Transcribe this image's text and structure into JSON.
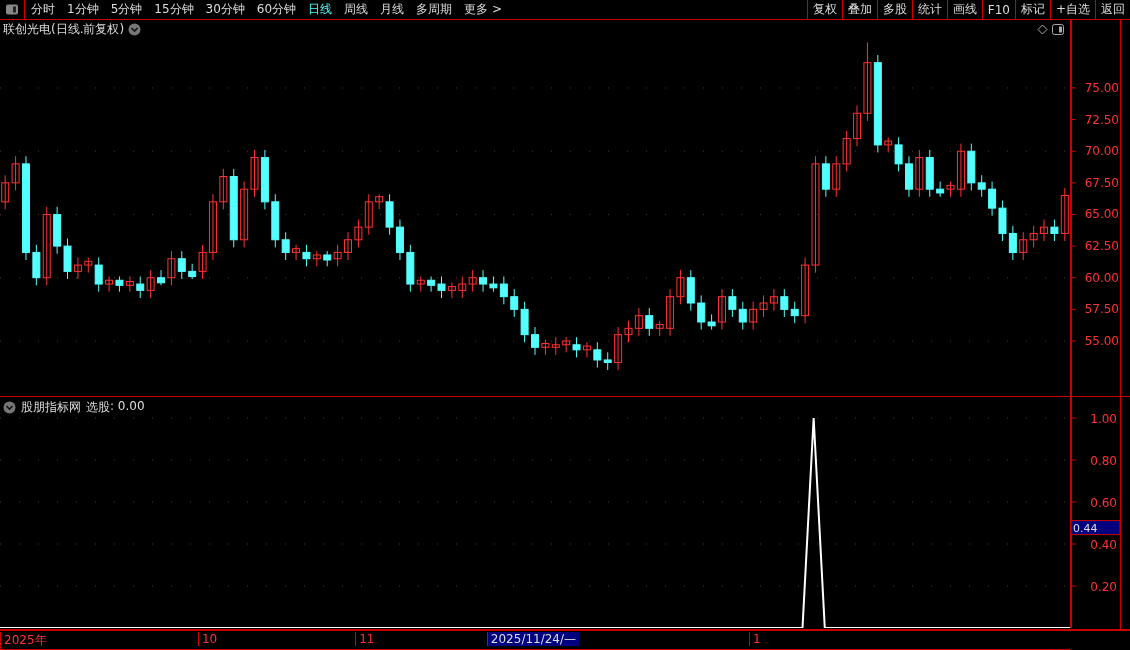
{
  "toolbar": {
    "periods": [
      {
        "label": "分时",
        "selected": false
      },
      {
        "label": "1分钟",
        "selected": false
      },
      {
        "label": "5分钟",
        "selected": false
      },
      {
        "label": "15分钟",
        "selected": false
      },
      {
        "label": "30分钟",
        "selected": false
      },
      {
        "label": "60分钟",
        "selected": false
      },
      {
        "label": "日线",
        "selected": true
      },
      {
        "label": "周线",
        "selected": false
      },
      {
        "label": "月线",
        "selected": false
      },
      {
        "label": "多周期",
        "selected": false
      },
      {
        "label": "更多 >",
        "selected": false
      }
    ],
    "actions": [
      "复权",
      "叠加",
      "多股",
      "统计",
      "画线",
      "F10",
      "标记",
      "+自选",
      "返回"
    ]
  },
  "main_chart": {
    "title": "联创光电(日线.前复权)",
    "chart_data": {
      "type": "candlestick",
      "ylim": [
        50.65,
        78.95
      ],
      "grid": true,
      "yticks": [
        {
          "value": 75,
          "label": "75.00"
        },
        {
          "value": 72.5,
          "label": "72.50"
        },
        {
          "value": 70,
          "label": "70.00"
        },
        {
          "value": 67.5,
          "label": "67.50"
        },
        {
          "value": 65,
          "label": "65.00"
        },
        {
          "value": 62.5,
          "label": "62.50"
        },
        {
          "value": 60,
          "label": "60.00"
        },
        {
          "value": 57.5,
          "label": "57.50"
        },
        {
          "value": 55,
          "label": "55.00"
        }
      ],
      "ohlc": [
        [
          66,
          68.1,
          65.4,
          67.5
        ],
        [
          67.5,
          69.6,
          66.9,
          69
        ],
        [
          69,
          69.6,
          61.4,
          62
        ],
        [
          62,
          62.6,
          59.4,
          60
        ],
        [
          60,
          65.6,
          59.4,
          65
        ],
        [
          65,
          65.6,
          61.9,
          62.5
        ],
        [
          62.5,
          63.1,
          59.9,
          60.5
        ],
        [
          60.5,
          61.6,
          59.9,
          61
        ],
        [
          61,
          61.6,
          60.4,
          61.3
        ],
        [
          61,
          61.6,
          58.9,
          59.5
        ],
        [
          59.5,
          60.1,
          58.9,
          59.8
        ],
        [
          59.8,
          60.1,
          58.9,
          59.4
        ],
        [
          59.4,
          60.1,
          58.9,
          59.7
        ],
        [
          59.5,
          60.1,
          58.4,
          59
        ],
        [
          59,
          60.6,
          58.4,
          60
        ],
        [
          60,
          60.6,
          59.4,
          59.6
        ],
        [
          60,
          62.1,
          59.4,
          61.5
        ],
        [
          61.5,
          62.1,
          59.9,
          60.5
        ],
        [
          60.5,
          61.1,
          59.9,
          60.1
        ],
        [
          60.5,
          62.6,
          59.9,
          62
        ],
        [
          62,
          66.6,
          61.4,
          66
        ],
        [
          66,
          68.6,
          65.4,
          68
        ],
        [
          68,
          68.6,
          62.4,
          63
        ],
        [
          63,
          67.6,
          62.4,
          67
        ],
        [
          67,
          70.1,
          66.4,
          69.5
        ],
        [
          69.5,
          70.1,
          65.4,
          66
        ],
        [
          66,
          66.6,
          62.4,
          63
        ],
        [
          63,
          63.6,
          61.4,
          62
        ],
        [
          62,
          62.6,
          61.4,
          62.3
        ],
        [
          62,
          62.6,
          60.9,
          61.5
        ],
        [
          61.5,
          62.1,
          60.9,
          61.8
        ],
        [
          61.8,
          62.1,
          60.9,
          61.4
        ],
        [
          61.5,
          62.6,
          60.9,
          62
        ],
        [
          62,
          63.6,
          61.4,
          63
        ],
        [
          63,
          64.6,
          62.4,
          64
        ],
        [
          64,
          66.6,
          63.4,
          66
        ],
        [
          66,
          66.6,
          65.4,
          66.4
        ],
        [
          66,
          66.6,
          63.4,
          64
        ],
        [
          64,
          64.6,
          61.4,
          62
        ],
        [
          62,
          62.6,
          58.9,
          59.5
        ],
        [
          59.5,
          60.1,
          58.9,
          59.8
        ],
        [
          59.8,
          60.1,
          58.9,
          59.4
        ],
        [
          59.5,
          60.1,
          58.4,
          59
        ],
        [
          59,
          59.6,
          58.4,
          59.3
        ],
        [
          59,
          60.1,
          58.4,
          59.5
        ],
        [
          59.5,
          60.6,
          58.9,
          60
        ],
        [
          60,
          60.6,
          58.9,
          59.5
        ],
        [
          59.5,
          60.1,
          58.9,
          59.2
        ],
        [
          59.5,
          60.1,
          57.9,
          58.5
        ],
        [
          58.5,
          59.1,
          56.9,
          57.5
        ],
        [
          57.5,
          58.1,
          54.9,
          55.5
        ],
        [
          55.5,
          56.1,
          53.9,
          54.5
        ],
        [
          54.5,
          55.1,
          53.9,
          54.8
        ],
        [
          54.5,
          55.3,
          53.9,
          54.7
        ],
        [
          54.7,
          55.3,
          54.1,
          55
        ],
        [
          54.7,
          55.3,
          53.7,
          54.3
        ],
        [
          54.3,
          54.9,
          53.7,
          54.6
        ],
        [
          54.3,
          54.9,
          52.9,
          53.5
        ],
        [
          53.5,
          54.1,
          52.7,
          53.3
        ],
        [
          53.3,
          56.1,
          52.7,
          55.5
        ],
        [
          55.5,
          56.6,
          54.9,
          56
        ],
        [
          56,
          57.6,
          55.4,
          57
        ],
        [
          57,
          57.6,
          55.4,
          56
        ],
        [
          56,
          56.6,
          55.4,
          56.3
        ],
        [
          56,
          59.1,
          55.4,
          58.5
        ],
        [
          58.5,
          60.6,
          57.9,
          60
        ],
        [
          60,
          60.6,
          57.4,
          58
        ],
        [
          58,
          58.6,
          55.9,
          56.5
        ],
        [
          56.5,
          57.1,
          55.9,
          56.2
        ],
        [
          56.5,
          59.1,
          55.9,
          58.5
        ],
        [
          58.5,
          59.1,
          56.9,
          57.5
        ],
        [
          57.5,
          58.1,
          55.9,
          56.5
        ],
        [
          56.5,
          58.1,
          55.9,
          57.5
        ],
        [
          57.5,
          58.6,
          56.9,
          58
        ],
        [
          58,
          59.1,
          57.4,
          58.5
        ],
        [
          58.5,
          59.1,
          56.9,
          57.5
        ],
        [
          57.5,
          58.1,
          56.4,
          57
        ],
        [
          57,
          61.6,
          56.4,
          61
        ],
        [
          61,
          69.6,
          60.4,
          69
        ],
        [
          69,
          69.6,
          66.4,
          67
        ],
        [
          67,
          69.6,
          66.4,
          69
        ],
        [
          69,
          71.6,
          68.4,
          71
        ],
        [
          71,
          73.6,
          70.4,
          73
        ],
        [
          73,
          78.6,
          72.4,
          77
        ],
        [
          77,
          77.6,
          69.9,
          70.5
        ],
        [
          70.5,
          71.1,
          69.9,
          70.8
        ],
        [
          70.5,
          71.1,
          68.4,
          69
        ],
        [
          69,
          69.6,
          66.4,
          67
        ],
        [
          67,
          70.1,
          66.4,
          69.5
        ],
        [
          69.5,
          70.1,
          66.4,
          67
        ],
        [
          67,
          67.6,
          66.4,
          66.7
        ],
        [
          67,
          67.6,
          66.4,
          67.3
        ],
        [
          67,
          70.6,
          66.4,
          70
        ],
        [
          70,
          70.6,
          66.9,
          67.5
        ],
        [
          67.5,
          68.1,
          66.4,
          67
        ],
        [
          67,
          67.6,
          64.9,
          65.5
        ],
        [
          65.5,
          66.1,
          62.9,
          63.5
        ],
        [
          63.5,
          64.1,
          61.4,
          62
        ],
        [
          62,
          63.6,
          61.4,
          63
        ],
        [
          63,
          64.1,
          62.4,
          63.5
        ],
        [
          63.5,
          64.6,
          62.9,
          64
        ],
        [
          64,
          64.6,
          62.9,
          63.5
        ],
        [
          63.5,
          67.1,
          62.9,
          66.5
        ]
      ]
    }
  },
  "indicator": {
    "name": "股朋指标网",
    "reading_value": ": 0.00",
    "cursor_value": "0.44",
    "chart_data": {
      "type": "line",
      "ylim": [
        0,
        1.1
      ],
      "grid": true,
      "yticks": [
        {
          "value": 0.2,
          "label": "0.20"
        },
        {
          "value": 0.4,
          "label": "0.40"
        },
        {
          "value": 0.6,
          "label": "0.60"
        },
        {
          "value": 0.8,
          "label": "0.80"
        },
        {
          "value": 1,
          "label": "1.00"
        }
      ],
      "series": [
        {
          "name": "选股",
          "color": "#ffffff",
          "values": [
            0,
            0,
            0,
            0,
            0,
            0,
            0,
            0,
            0,
            0,
            0,
            0,
            0,
            0,
            0,
            0,
            0,
            0,
            0,
            0,
            0,
            0,
            0,
            0,
            0,
            0,
            0,
            0,
            0,
            0,
            0,
            0,
            0,
            0,
            0,
            0,
            0,
            0,
            0,
            0,
            0,
            0,
            0,
            0,
            0,
            0,
            0,
            0,
            0,
            0,
            0,
            0,
            0,
            0,
            0,
            0,
            0,
            0,
            0,
            0,
            0,
            0,
            0,
            0,
            0,
            0,
            0,
            0,
            0,
            0,
            0,
            0,
            0,
            1,
            0,
            0,
            0,
            0,
            0,
            0,
            0,
            0,
            0,
            0,
            0,
            0,
            0,
            0,
            0,
            0,
            0,
            0,
            0,
            0,
            0,
            0,
            0
          ]
        }
      ]
    }
  },
  "date_axis": [
    {
      "label": "2025年",
      "selected": false
    },
    {
      "label": "10",
      "selected": false
    },
    {
      "label": "11",
      "selected": false
    },
    {
      "label": "2025/11/24/—",
      "selected": true
    },
    {
      "label": "1",
      "selected": false
    }
  ]
}
